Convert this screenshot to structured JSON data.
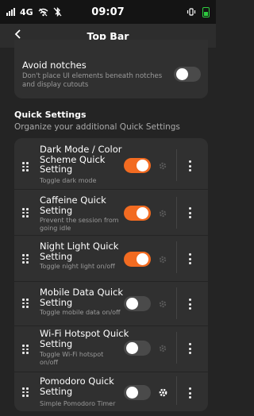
{
  "status_bar": {
    "network": "4G",
    "time": "09:07"
  },
  "header": {
    "title": "Top Bar"
  },
  "avoid_notches": {
    "title": "Avoid notches",
    "subtitle": "Don't place UI elements beneath notches and display cutouts",
    "enabled": false
  },
  "quick_settings": {
    "title": "Quick Settings",
    "subtitle": "Organize your additional Quick Settings",
    "items": [
      {
        "title": "Dark Mode / Color Scheme Quick Setting",
        "subtitle": "Toggle dark mode",
        "enabled": true,
        "settings_active": false
      },
      {
        "title": "Caffeine Quick Setting",
        "subtitle": "Prevent the session from going idle",
        "enabled": true,
        "settings_active": false
      },
      {
        "title": "Night Light Quick Setting",
        "subtitle": "Toggle night light on/off",
        "enabled": true,
        "settings_active": false
      },
      {
        "title": "Mobile Data Quick Setting",
        "subtitle": "Toggle mobile data on/off",
        "enabled": false,
        "settings_active": false
      },
      {
        "title": "Wi-Fi Hotspot Quick Setting",
        "subtitle": "Toggle Wi-Fi hotspot on/off",
        "enabled": false,
        "settings_active": false
      },
      {
        "title": "Pomodoro Quick Setting",
        "subtitle": "Simple Pomodoro Timer",
        "enabled": false,
        "settings_active": true
      }
    ]
  },
  "colors": {
    "accent": "#f26b21",
    "toggle_off": "#4a4a4a",
    "gear_inactive": "#5a5a5a",
    "gear_active": "#ffffff"
  },
  "icons": {
    "back": "arrow-left-icon",
    "drag": "drag-handle-icon",
    "settings": "gear-icon",
    "menu": "more-vertical-icon"
  }
}
